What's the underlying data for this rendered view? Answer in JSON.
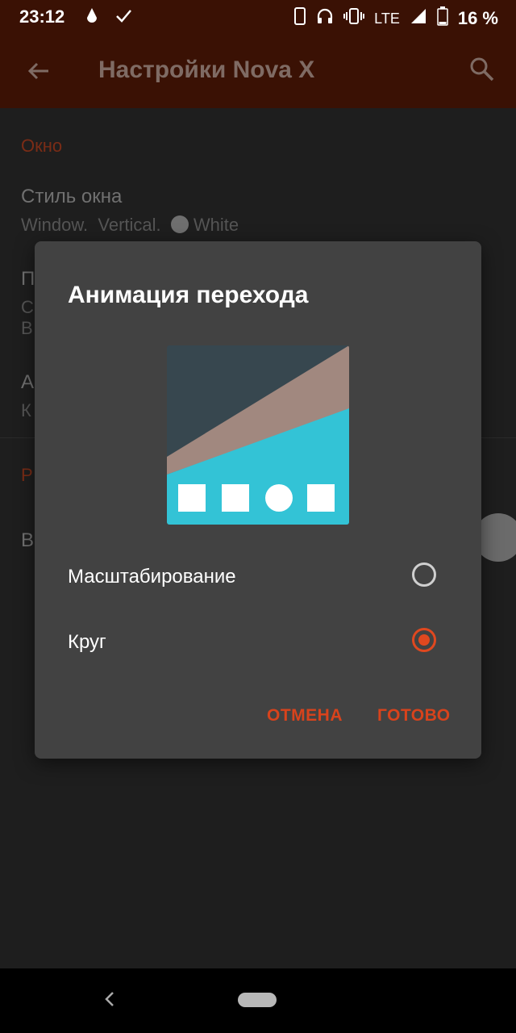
{
  "status_bar": {
    "time": "23:12",
    "network": "LTE",
    "battery": "16 %",
    "left_icons": [
      "notification-drop-icon",
      "check-icon"
    ],
    "right_icons": [
      "phone-icon",
      "headphones-icon",
      "vibrate-icon",
      "signal-icon",
      "battery-icon"
    ]
  },
  "app_bar": {
    "title": "Настройки Nova X",
    "back_icon": "arrow-left-icon",
    "search_icon": "search-icon"
  },
  "background_list": {
    "section1": "Окно",
    "item1_title": "Стиль окна",
    "item1_sub_a": "Window.",
    "item1_sub_b": "Vertical.",
    "item1_sub_c": "White",
    "item2_title": "П",
    "item2_sub_a": "С",
    "item2_sub_b": "В",
    "item3_title": "А",
    "item3_sub": "К",
    "section2": "Р",
    "item4_title": "В"
  },
  "dialog": {
    "title": "Анимация перехода",
    "options": [
      {
        "label": "Масштабирование",
        "selected": false
      },
      {
        "label": "Круг",
        "selected": true
      }
    ],
    "cancel_label": "ОТМЕНА",
    "done_label": "ГОТОВО"
  },
  "colors": {
    "accent": "#e0481f",
    "appbar": "#3a1104",
    "dialog_bg": "#424242",
    "preview_dark": "#37474f",
    "preview_tan": "#a1887f",
    "preview_cyan": "#33c3d6"
  }
}
